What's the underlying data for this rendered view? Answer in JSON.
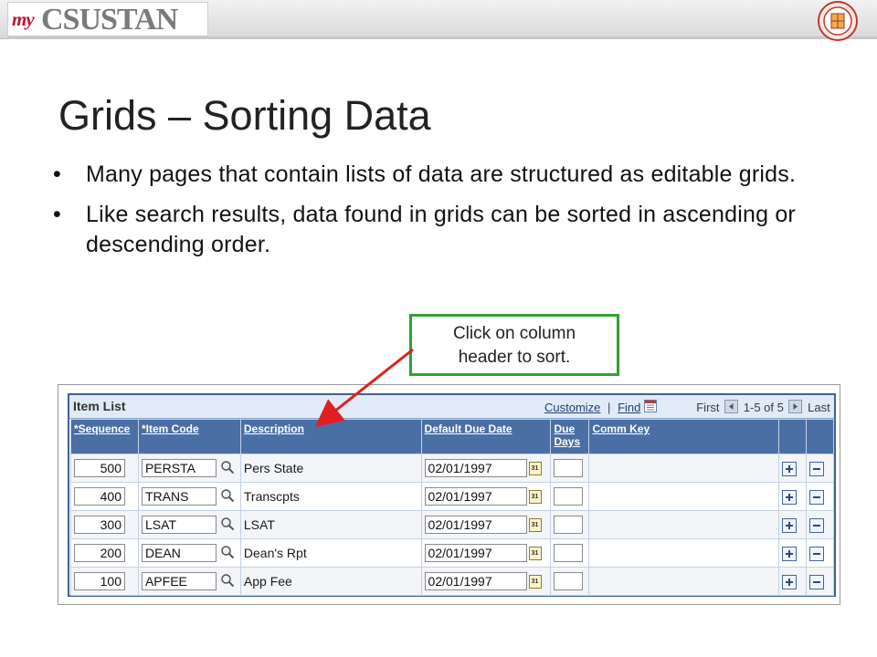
{
  "banner": {
    "logo_my": "my",
    "logo_text": "CSUSTAN",
    "seal_icon": "university-seal-icon"
  },
  "slide": {
    "title": "Grids – Sorting Data",
    "bullets": [
      "Many pages that contain lists of data are structured as editable grids.",
      "Like search results, data found in grids can be sorted in ascending or descending order."
    ],
    "bullet_char": "•"
  },
  "callout": {
    "line1": "Click on column",
    "line2": "header to sort.",
    "border_color": "#30a030",
    "arrow_color": "#e02020"
  },
  "grid": {
    "title": "Item List",
    "customize": "Customize",
    "find": "Find",
    "separator": "|",
    "first": "First",
    "range": "1-5 of 5",
    "last": "Last",
    "columns": {
      "sequence": "*Sequence",
      "item_code": "*Item Code",
      "description": "Description",
      "default_due_date": "Default Due Date",
      "due_days_1": "Due",
      "due_days_2": "Days",
      "comm_key": "Comm Key"
    },
    "rows": [
      {
        "sequence": "500",
        "item_code": "PERSTA",
        "description": "Pers State",
        "due_date": "02/01/1997"
      },
      {
        "sequence": "400",
        "item_code": "TRANS",
        "description": "Transcpts",
        "due_date": "02/01/1997"
      },
      {
        "sequence": "300",
        "item_code": "LSAT",
        "description": "LSAT",
        "due_date": "02/01/1997"
      },
      {
        "sequence": "200",
        "item_code": "DEAN",
        "description": "Dean's Rpt",
        "due_date": "02/01/1997"
      },
      {
        "sequence": "100",
        "item_code": "APFEE",
        "description": "App Fee",
        "due_date": "02/01/1997"
      }
    ],
    "calendar_label": "31",
    "header_color": "#4a6fa5"
  }
}
